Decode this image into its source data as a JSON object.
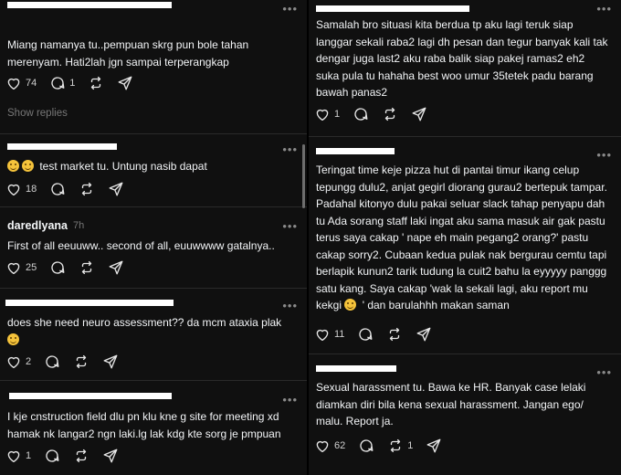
{
  "left": {
    "comments": [
      {
        "username": "",
        "ago": "",
        "text": "Miang namanya tu..pempuan skrg pun bole tahan merenyam. Hati2lah jgn sampai terperangkap",
        "likes": "74",
        "replies": "1",
        "reposts": "",
        "show_replies": "Show replies"
      },
      {
        "username": "",
        "ago": "",
        "text": " test market tu. Untung nasib dapat",
        "likes": "18",
        "replies": "",
        "reposts": ""
      },
      {
        "username": "daredlyana",
        "ago": "7h",
        "text": "First of all eeuuww.. second of all, euuwwww gatalnya..",
        "likes": "25",
        "replies": "",
        "reposts": ""
      },
      {
        "username": "",
        "ago": "",
        "text": "does she need neuro assessment?? da mcm ataxia plak",
        "likes": "2",
        "replies": "",
        "reposts": ""
      },
      {
        "username": "",
        "ago": "",
        "text": "I kje cnstruction field dlu pn klu kne g site for meeting xd hamak nk langar2 ngn laki.lg lak kdg kte sorg je pmpuan",
        "likes": "1",
        "replies": "",
        "reposts": ""
      }
    ]
  },
  "right": {
    "comments": [
      {
        "username": "",
        "ago": "",
        "text": "Samalah bro situasi kita berdua tp aku lagi teruk siap langgar sekali raba2 lagi dh pesan dan tegur banyak kali tak dengar juga last2 aku raba balik siap pakej ramas2 eh2 suka pula tu hahaha best woo umur 35tetek padu barang bawah panas2",
        "likes": "1",
        "replies": "",
        "reposts": ""
      },
      {
        "username": "",
        "ago": "",
        "text": "Teringat time keje pizza hut di pantai timur  ikang celup tepungg dulu2, anjat gegirl diorang gurau2 bertepuk tampar. Padahal kitonyo dulu pakai seluar slack tahap penyapu dah tu Ada sorang staff laki ingat aku sama masuk air gak pastu terus saya cakap ' nape eh main pegang2 orang?' pastu cakap sorry2. Cubaan kedua pulak nak bergurau cemtu tapi berlapik kunun2 tarik tudung la cuit2 bahu la eyyyyy panggg satu kang. Saya cakap 'wak la sekali lagi, aku report mu kekgi ",
        "text_tail": " ' dan barulahhh makan saman",
        "likes": "11",
        "replies": "",
        "reposts": ""
      },
      {
        "username": "",
        "ago": "",
        "text": "Sexual harassment tu. Bawa ke HR. Banyak case lelaki diamkan diri bila kena sexual harassment. Jangan ego/ malu. Report ja.",
        "likes": "62",
        "replies": "",
        "reposts": "1"
      }
    ]
  },
  "icons": [
    "heart-icon",
    "comment-icon",
    "repost-icon",
    "share-icon",
    "more-icon"
  ],
  "colors": {
    "background": "#101010",
    "text": "#f3f5f7",
    "muted": "#777777",
    "redaction": "#ffffff"
  }
}
